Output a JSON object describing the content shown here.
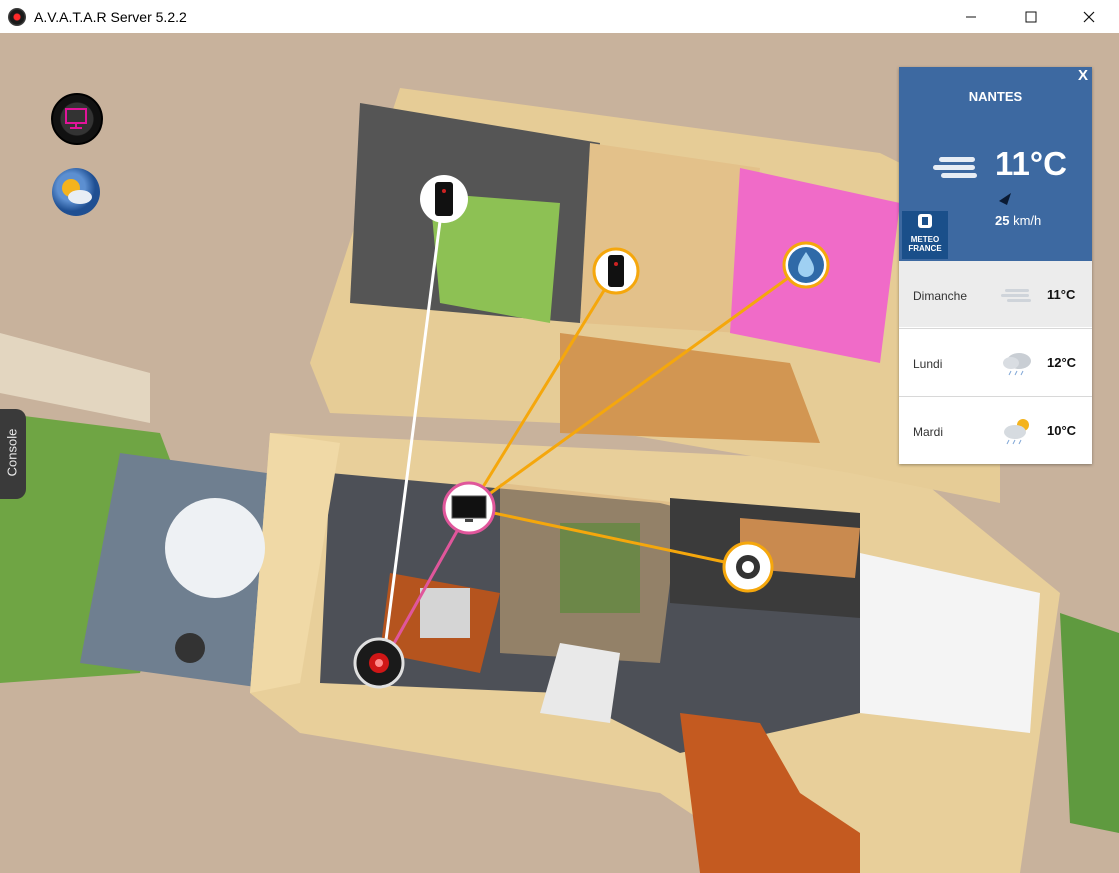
{
  "window": {
    "title": "A.V.A.T.A.R Server 5.2.2",
    "minimize": "—",
    "maximize": "☐",
    "close": "✕"
  },
  "sidebar": {
    "console_label": "Console"
  },
  "weather": {
    "city": "NANTES",
    "close_label": "X",
    "current_temp": "11°C",
    "wind_speed": "25",
    "wind_unit": "km/h",
    "logo_text": "METEO FRANCE",
    "forecast": [
      {
        "day": "Dimanche",
        "temp": "11°C",
        "icon": "fog-icon"
      },
      {
        "day": "Lundi",
        "temp": "12°C",
        "icon": "rain-cloud-icon"
      },
      {
        "day": "Mardi",
        "temp": "10°C",
        "icon": "sun-rain-icon"
      }
    ]
  }
}
